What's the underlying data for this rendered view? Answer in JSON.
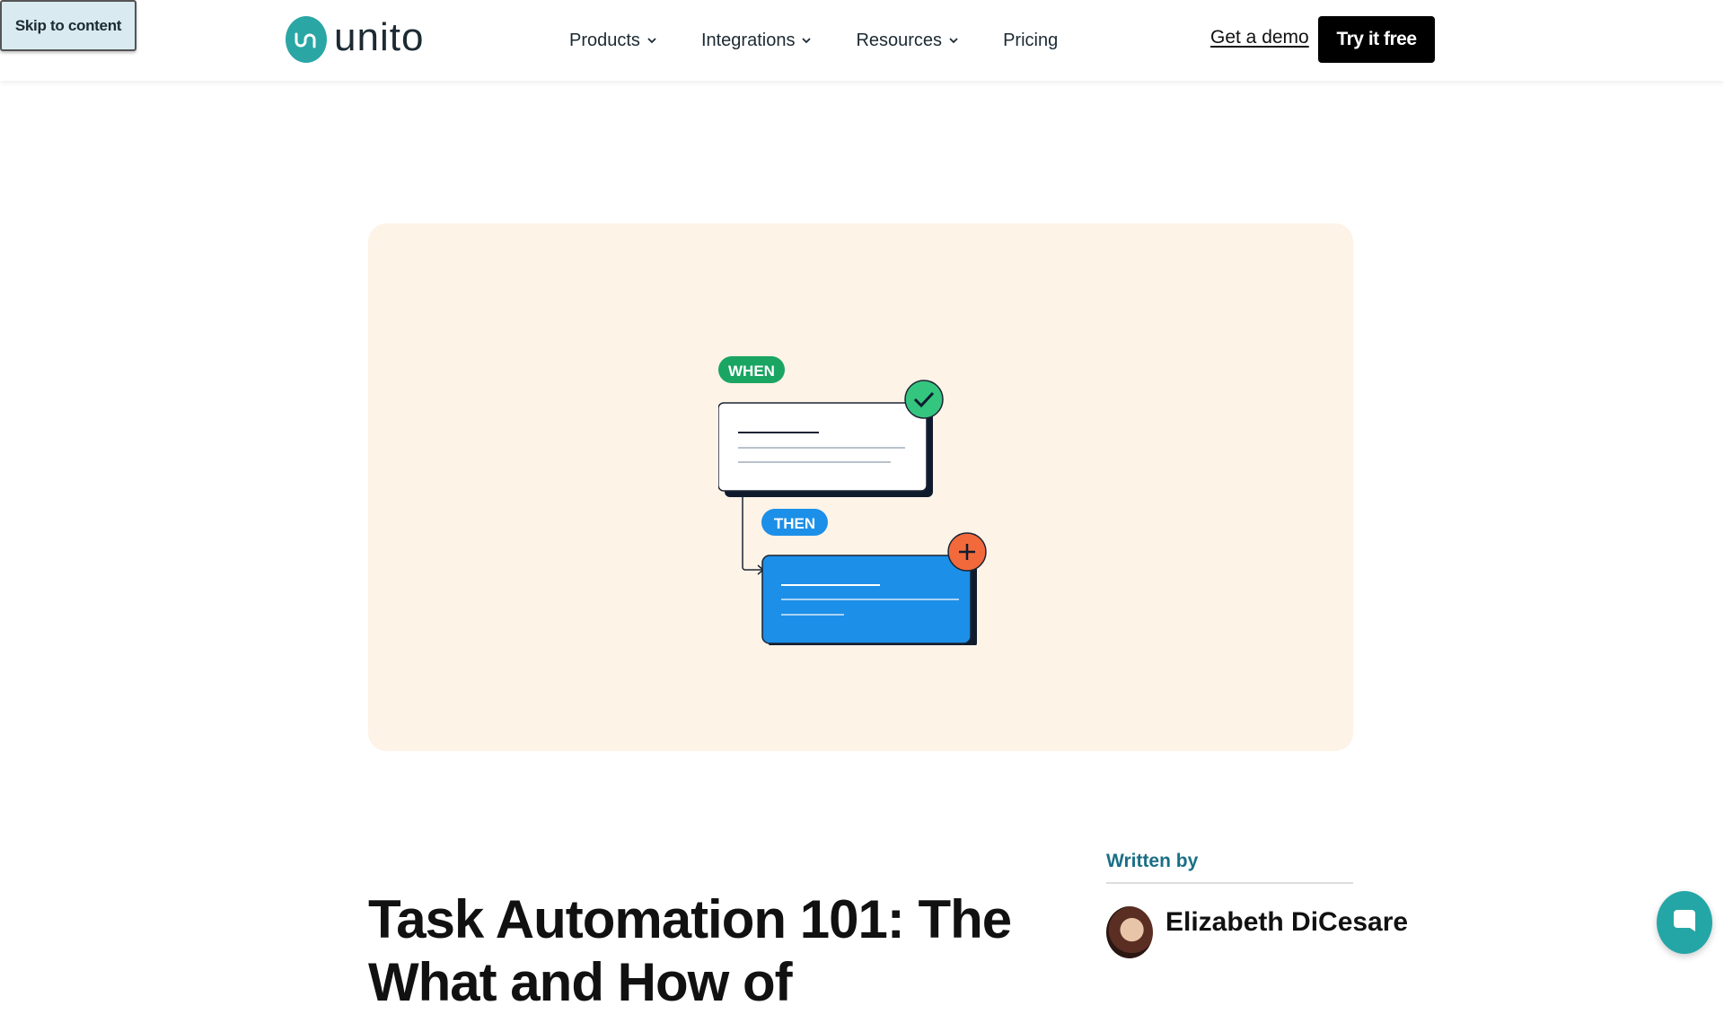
{
  "skip_link": "Skip to content",
  "brand": {
    "name": "unito",
    "accent": "#2aa6a5"
  },
  "nav": {
    "items": [
      {
        "label": "Products",
        "has_dropdown": true
      },
      {
        "label": "Integrations",
        "has_dropdown": true
      },
      {
        "label": "Resources",
        "has_dropdown": true
      },
      {
        "label": "Pricing",
        "has_dropdown": false
      }
    ],
    "demo_link": "Get a demo",
    "cta_button": "Try it free"
  },
  "hero": {
    "background": "#fdf3e7",
    "when_label": "WHEN",
    "then_label": "THEN",
    "when_color": "#1aa562",
    "then_color": "#1c8fe8",
    "check_color": "#34c57f",
    "plus_color": "#f26a3c"
  },
  "article": {
    "title": "Task Automation 101: The What and How of",
    "written_by_label": "Written by",
    "author": "Elizabeth DiCesare"
  },
  "icons": [
    "chevron-down-icon",
    "check-icon",
    "plus-icon",
    "chat-icon",
    "unito-logo-icon"
  ]
}
